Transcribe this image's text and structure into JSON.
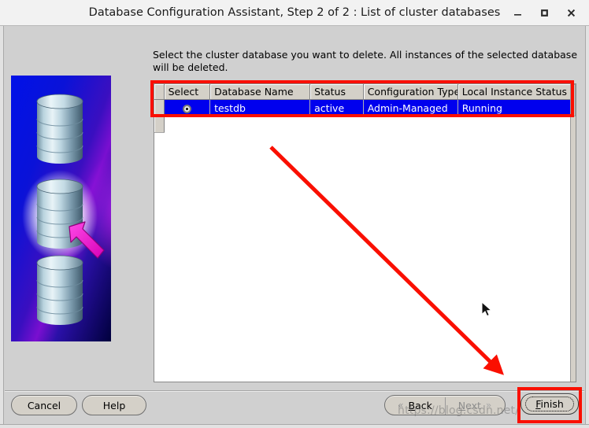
{
  "window": {
    "title": "Database Configuration Assistant, Step 2 of 2 : List of cluster databases",
    "minimize_label": "minimize-icon",
    "maximize_label": "maximize-icon",
    "close_label": "close-icon"
  },
  "main": {
    "instruction": "Select the cluster database you want to delete. All instances of the selected database will be deleted."
  },
  "table": {
    "columns": [
      "Select",
      "Database Name",
      "Status",
      "Configuration Type",
      "Local Instance Status"
    ],
    "rows": [
      {
        "select": "radio-selected",
        "database_name": "testdb",
        "status": "active",
        "configuration_type": "Admin-Managed",
        "local_instance_status": "Running",
        "selected": true
      }
    ]
  },
  "buttons": {
    "cancel": "Cancel",
    "help": "Help",
    "back": "Back",
    "next": "Next",
    "finish": "Finish",
    "back_chevron": "«",
    "next_chevron": "»"
  },
  "watermark": {
    "text": "https://blog.csdn.net/"
  },
  "colors": {
    "annotation_red": "#fa0f00",
    "selection_blue": "#0000ee",
    "window_bg": "#d4d0c8",
    "arrow_magenta": "#ef31d6"
  },
  "graphic": {
    "name": "three-database-cylinders-with-arrow"
  }
}
